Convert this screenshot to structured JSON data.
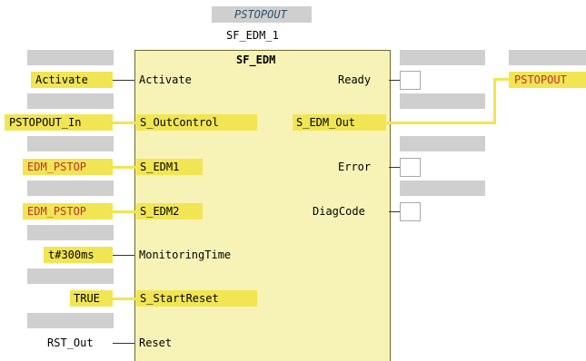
{
  "block": {
    "instance_name": "PSTOPOUT",
    "instance_id": "SF_EDM_1",
    "type": "SF_EDM"
  },
  "inputs": [
    {
      "pin": "Activate",
      "value": "Activate"
    },
    {
      "pin": "S_OutControl",
      "value": "PSTOPOUT_In"
    },
    {
      "pin": "S_EDM1",
      "value": "EDM_PSTOP"
    },
    {
      "pin": "S_EDM2",
      "value": "EDM_PSTOP"
    },
    {
      "pin": "MonitoringTime",
      "value": "t#300ms"
    },
    {
      "pin": "S_StartReset",
      "value": "TRUE"
    },
    {
      "pin": "Reset",
      "value": "RST_Out"
    }
  ],
  "outputs": [
    {
      "pin": "Ready",
      "value": ""
    },
    {
      "pin": "S_EDM_Out",
      "value": "PSTOPOUT"
    },
    {
      "pin": "Error",
      "value": ""
    },
    {
      "pin": "DiagCode",
      "value": ""
    }
  ],
  "colors": {
    "block_fill": "#f7f3b6",
    "safety_highlight": "#f1e553",
    "safety_variable": "#c03030",
    "placeholder_gray": "#cfcfcf"
  }
}
